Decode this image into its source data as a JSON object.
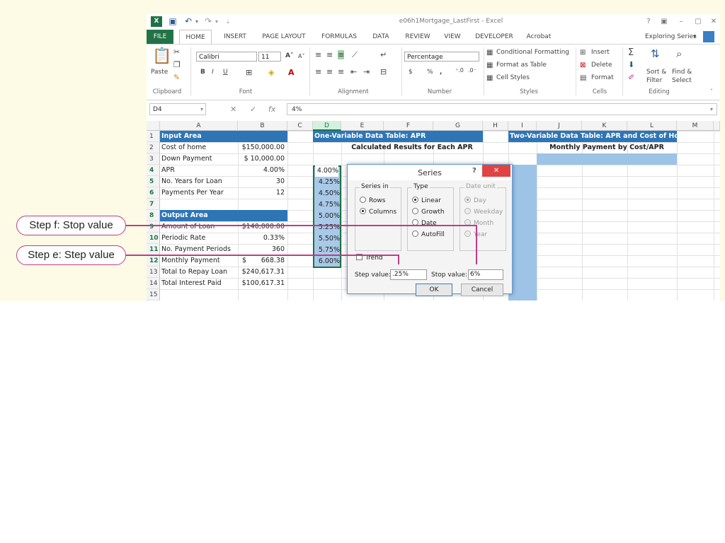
{
  "window": {
    "title": "e06h1Mortgage_LastFirst - Excel",
    "help": "?",
    "controls": [
      "▣",
      "–",
      "▢",
      "✕"
    ]
  },
  "tabs": [
    "FILE",
    "HOME",
    "INSERT",
    "PAGE LAYOUT",
    "FORMULAS",
    "DATA",
    "REVIEW",
    "VIEW",
    "DEVELOPER",
    "Acrobat"
  ],
  "active_tab": "HOME",
  "account": "Exploring Series",
  "ribbon": {
    "clipboard": {
      "label": "Clipboard",
      "paste": "Paste"
    },
    "font": {
      "label": "Font",
      "name": "Calibri",
      "size": "11",
      "bold": "B",
      "italic": "I",
      "underline": "U"
    },
    "alignment": {
      "label": "Alignment"
    },
    "number": {
      "label": "Number",
      "format": "Percentage",
      "currency": "$",
      "percent": "%",
      "comma": ","
    },
    "styles": {
      "label": "Styles",
      "conditional": "Conditional Formatting",
      "format_table": "Format as Table",
      "cell_styles": "Cell Styles"
    },
    "cells": {
      "label": "Cells",
      "insert": "Insert",
      "delete": "Delete",
      "format": "Format"
    },
    "editing": {
      "label": "Editing",
      "sort": "Sort &",
      "filter": "Filter",
      "find": "Find &",
      "select": "Select"
    }
  },
  "formula_bar": {
    "name_box": "D4",
    "cancel": "✕",
    "enter": "✓",
    "fx": "fx",
    "value": "4%"
  },
  "columns": [
    "A",
    "B",
    "C",
    "D",
    "E",
    "F",
    "G",
    "H",
    "I",
    "J",
    "K",
    "L",
    "M"
  ],
  "rows": [
    "1",
    "2",
    "3",
    "4",
    "5",
    "6",
    "7",
    "8",
    "9",
    "10",
    "11",
    "12",
    "13",
    "14",
    "15"
  ],
  "sheet": {
    "input_header": "Input Area",
    "inputs": [
      {
        "label": "Cost of home",
        "value": "$150,000.00"
      },
      {
        "label": "Down Payment",
        "value": "$ 10,000.00"
      },
      {
        "label": "APR",
        "value": "4.00%"
      },
      {
        "label": "No. Years for Loan",
        "value": "30"
      },
      {
        "label": "Payments Per Year",
        "value": "12"
      }
    ],
    "output_header": "Output Area",
    "outputs": [
      {
        "label": "Amount of Loan",
        "value": "$140,000.00"
      },
      {
        "label": "Periodic Rate",
        "value": "0.33%"
      },
      {
        "label": "No. Payment Periods",
        "value": "360"
      },
      {
        "label": "Monthly Payment",
        "currency": "$",
        "value": "668.38"
      },
      {
        "label": "Total to Repay Loan",
        "value": "$240,617.31"
      },
      {
        "label": "Total Interest Paid",
        "value": "$100,617.31"
      }
    ],
    "one_var_header": "One-Variable Data Table: APR",
    "one_var_sub": "Calculated Results for Each APR",
    "apr_series": [
      "4.00%",
      "4.25%",
      "4.50%",
      "4.75%",
      "5.00%",
      "5.25%",
      "5.50%",
      "5.75%",
      "6.00%"
    ],
    "two_var_header": "Two-Variable Data Table: APR and Cost of Home",
    "two_var_sub": "Monthly Payment by Cost/APR"
  },
  "dialog": {
    "title": "Series",
    "help": "?",
    "close": "✕",
    "series_in": {
      "label": "Series in",
      "options": [
        "Rows",
        "Columns"
      ],
      "selected": "Columns"
    },
    "type": {
      "label": "Type",
      "options": [
        "Linear",
        "Growth",
        "Date",
        "AutoFill"
      ],
      "selected": "Linear"
    },
    "date_unit": {
      "label": "Date unit",
      "options": [
        "Day",
        "Weekday",
        "Month",
        "Year"
      ],
      "selected": "Day"
    },
    "trend": "Trend",
    "step_label": "Step value:",
    "step_value": ".25%",
    "stop_label": "Stop value:",
    "stop_value": "6%",
    "ok": "OK",
    "cancel": "Cancel"
  },
  "callouts": {
    "stop": "Step f: Stop value",
    "step": "Step e: Step value"
  },
  "colors": {
    "excel_green": "#217346",
    "header_blue": "#2e75b6",
    "callout": "#c33a8a",
    "background": "#fdfbe6"
  }
}
